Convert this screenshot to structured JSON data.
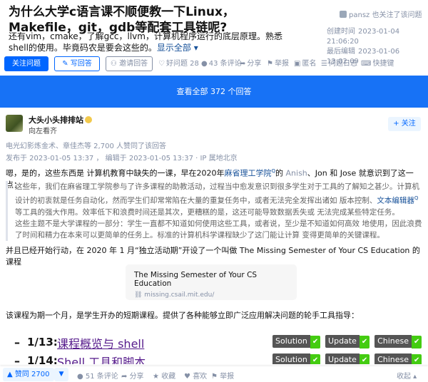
{
  "question": {
    "title": "为什么大学c语言课不顺便教一下Linux，Makefile，git，gdb等配套工具链呢?",
    "description": "还有vim，cmake，了解gcc，llvm，计算机程序运行的底层原理。熟悉shell的使用。毕竟码农是要会这些的。",
    "show_all": "显示全部 ▾",
    "follower_note": "pansz 也关注了该问题",
    "created_label": "创建时间",
    "created_time": "2023-01-04 21:06:20",
    "edited_label": "最后编辑",
    "edited_time": "2023-01-06 13:02:09",
    "follow_button": "关注问题",
    "answer_button": "写回答",
    "invite_button": "邀请回答",
    "good_question": "好问题 28",
    "comments": "43 条评论",
    "share": "分享",
    "report": "举报",
    "anonymous": "匿名",
    "log": "问题日志",
    "shortcut": "快捷键"
  },
  "view_all": "查看全部 372 个回答",
  "answer": {
    "author_name": "大头小头排排站",
    "author_bio": "向左看齐",
    "follow_button": "+ 关注",
    "voters": "电光幻影炼金术、章佳杰等 2,700 人赞同了该回答",
    "publish_time": "发布于 2023-01-05 13:37 ，  编辑于 2023-01-05 13:37 · IP 属地北京",
    "p1_a": "嗯，是的，这些东西是 计算机教育中缺失的一课，早在2020年",
    "p1_link": "麻省理工学院",
    "p1_sup": "Q",
    "p1_b": "的 ",
    "p1_m1": "Anish",
    "p1_c": "、",
    "p1_m2": "Jon",
    "p1_d": " 和 ",
    "p1_m3": "Jose",
    "p1_e": " 就意识到了这一点：",
    "quote_a": "这些年，我们在麻省理工学院参与了许多课程的助教活动，过程当中愈发意识到很多学生对于工具的了解知之甚少。计算机设计的初衷就是任务自动化，然而学生们却常常陷在大量的重复任务中，或者无法完全发挥出诸如 版本控制、",
    "quote_link": "文本编辑器",
    "quote_sup": "Q",
    "quote_b": "等工具的强大作用。效率低下和浪费时间还是其次，更糟糕的是，这还可能导致数据丢失或 无法完成某些特定任务。",
    "quote_c": "这些主题不是大学课程的一部分：学生一直都不知道如何使用这些工具，或者说，至少是不知道如何高效 地使用，因此浪费了时间和精力在本来可以更简单的任务上。标准的计算机科学课程缺少了这门能让计算 变得更简单的关键课程。",
    "p2": "并且已经开始行动，在 2020 年 1 月“独立活动期”开设了一个叫做 The Missing Semester of Your CS Education 的课程",
    "card_title": "The Missing Semester of Your CS Education",
    "card_url": "missing.csail.mit.edu/",
    "p3": "该课程为期一个月，是学生开办的短期课程。提供了各种能够立即广泛应用解决问题的轮手工具指导：",
    "lessons": [
      {
        "num": "1/13:",
        "title": "课程概览与 shell"
      },
      {
        "num": "1/14:",
        "title": "Shell 工具和脚本"
      }
    ],
    "tags": [
      {
        "label": "Solution",
        "mark": "✔"
      },
      {
        "label": "Update",
        "mark": "✔"
      },
      {
        "label": "Chinese",
        "mark": "✔"
      }
    ]
  },
  "bottom_bar": {
    "upvote": "▲ 赞同 2700",
    "downvote": "▼",
    "comments": "51 条评论",
    "share": "分享",
    "favorite": "收藏",
    "like": "喜欢",
    "more": "···",
    "report": "举报",
    "collapse": "收起 ▴"
  },
  "colors": {
    "accent": "#0066ff",
    "bar": "#1772f6",
    "link": "#175199",
    "muted": "#8590a6"
  }
}
